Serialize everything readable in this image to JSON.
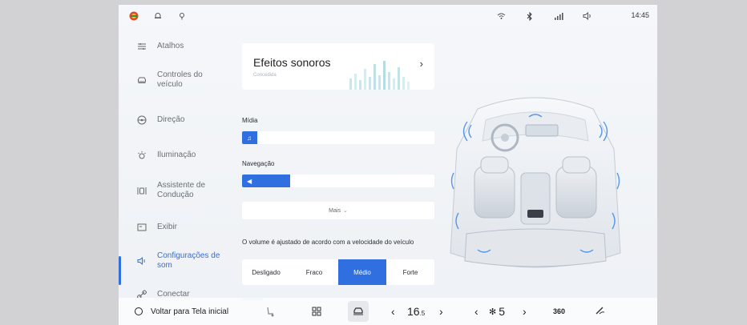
{
  "status": {
    "time": "14:45",
    "left_icons": [
      "profile-icon",
      "bell-icon",
      "location-icon"
    ],
    "right_icons": [
      "wifi-icon",
      "bluetooth-icon",
      "signal-icon",
      "volume-icon"
    ]
  },
  "sidebar": {
    "items": [
      {
        "label": "Atalhos",
        "icon": "shortcuts-icon"
      },
      {
        "label": "Controles do veículo",
        "icon": "car-icon"
      },
      {
        "label": "Direção",
        "icon": "steering-icon"
      },
      {
        "label": "Iluminação",
        "icon": "light-icon"
      },
      {
        "label": "Assistente de Condução",
        "icon": "driver-assist-icon"
      },
      {
        "label": "Exibir",
        "icon": "display-icon"
      },
      {
        "label": "Configurações de som",
        "icon": "sound-icon",
        "active": true
      },
      {
        "label": "Conectar",
        "icon": "link-icon"
      }
    ]
  },
  "panel": {
    "effects_title": "Efeitos sonoros",
    "effects_subtitle": "Concedida",
    "media_label": "Mídia",
    "media_level": 0.08,
    "nav_label": "Navegação",
    "nav_level": 0.25,
    "mais_label": "Mais",
    "volume_note": "O volume é ajustado de acordo com a velocidade do veículo",
    "speed_options": [
      "Desligado",
      "Fraco",
      "Médio",
      "Forte"
    ],
    "speed_selected": 2
  },
  "dock": {
    "home_label": "Voltar para Tela inicial",
    "temp": "16",
    "temp_sub": ".5",
    "fan": "5",
    "view_360": "360"
  },
  "colors": {
    "accent": "#2f6fe0"
  }
}
